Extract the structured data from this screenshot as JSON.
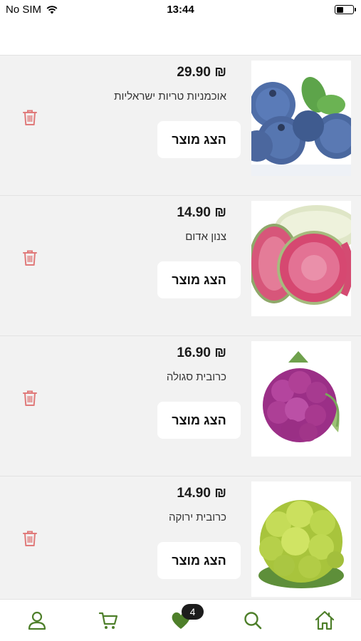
{
  "status_bar": {
    "carrier": "No SIM",
    "time": "13:44",
    "battery_level": 0.45
  },
  "cart": {
    "items": [
      {
        "price": "29.90 ₪",
        "name": "אוכמניות טריות ישראליות",
        "button": "הצג מוצר",
        "image": "blueberries"
      },
      {
        "price": "14.90 ₪",
        "name": "צנון אדום",
        "button": "הצג מוצר",
        "image": "red-radish"
      },
      {
        "price": "16.90 ₪",
        "name": "כרובית סגולה",
        "button": "הצג מוצר",
        "image": "purple-cauliflower"
      },
      {
        "price": "14.90 ₪",
        "name": "כרובית ירוקה",
        "button": "הצג מוצר",
        "image": "green-cauliflower"
      }
    ]
  },
  "tabbar": {
    "tabs": [
      "profile-icon",
      "cart-icon",
      "favorites-heart-icon",
      "search-icon",
      "home-icon"
    ],
    "favorites_badge": "4",
    "accent_color": "#4e7f2a"
  },
  "colors": {
    "trash": "#e07a7a",
    "background": "#f2f2f2"
  }
}
